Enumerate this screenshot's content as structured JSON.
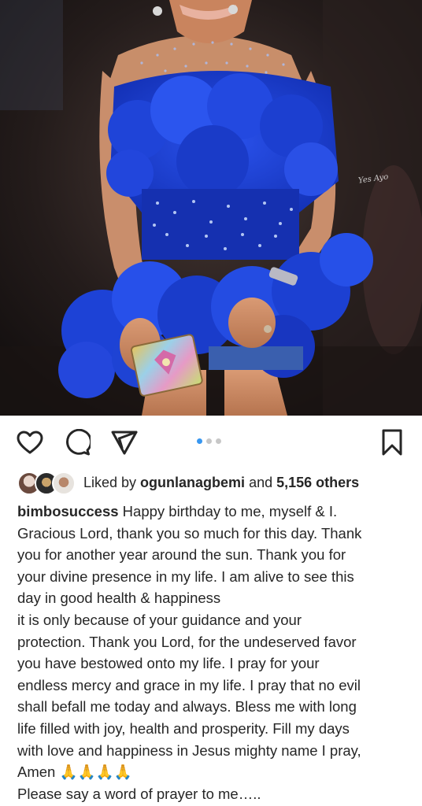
{
  "photo": {
    "alt_subject": "woman in blue ruffled tulle dress holding glittery clutch",
    "watermark": "Yes Ayo",
    "colors": {
      "background": "#1d1716",
      "dress": "#1e3fd4",
      "skin": "#c98a67"
    }
  },
  "actions": {
    "like_icon": "heart-icon",
    "comment_icon": "comment-icon",
    "share_icon": "send-icon",
    "save_icon": "bookmark-icon",
    "carousel_total": 3,
    "carousel_index": 1,
    "accent": "#3897f0"
  },
  "likes": {
    "prefix": "Liked by ",
    "user": "ogunlanagbemi",
    "middle": " and ",
    "count": "5,156 others"
  },
  "caption": {
    "username": "bimbosuccess",
    "first_line_rest": " Happy birthday to me, myself & I.",
    "lines": [
      "Gracious Lord, thank you so much for this day. Thank",
      "you for another year around the sun. Thank you for",
      "your divine presence in my life. I am alive to see this",
      "day in good health & happiness",
      "it is only because of your guidance and your",
      "protection. Thank you Lord, for the undeserved favor",
      "you have bestowed onto my life. I pray for your",
      "endless mercy and grace in my life. I pray that no evil",
      "shall befall me today and always. Bless me with long",
      "life filled with joy, health and prosperity. Fill my days",
      "with love and happiness in Jesus mighty name I pray,",
      "Amen 🙏🙏🙏🙏",
      "Please say a word of prayer to me….."
    ]
  }
}
